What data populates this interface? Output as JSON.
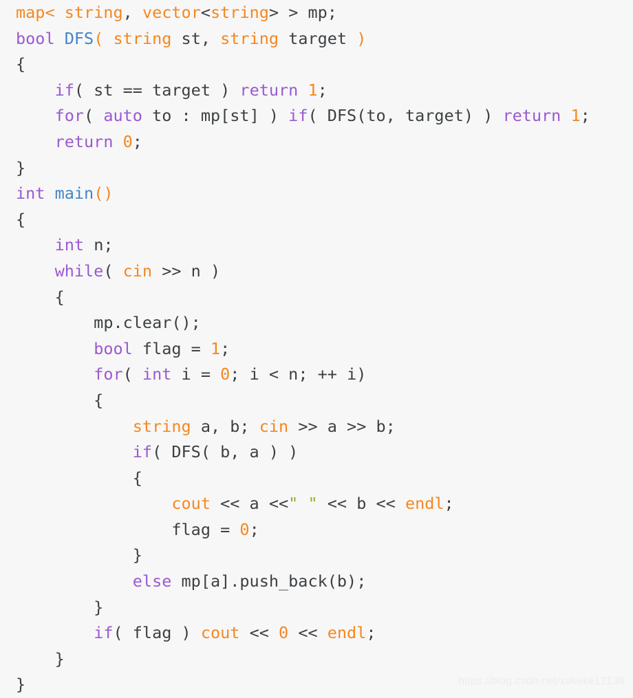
{
  "editor": {
    "language": "C++",
    "background_color": "#f7f7f7",
    "default_text_color": "#3c4043",
    "font_size_px": 23,
    "line_height_px": 37.6,
    "indent_spaces": 4
  },
  "syntax_colors": {
    "keyword": "#9b59d0",
    "type": "#f5871f",
    "builtin": "#f5871f",
    "number": "#f5871f",
    "function_declaration": "#4285c8",
    "string_literal": "#9aaa28",
    "plain": "#3c4043",
    "bracket_highlight": "#f5871f"
  },
  "watermark": {
    "text": "https://blog.csdn.net/xukeke12138",
    "color": "#ececec"
  },
  "code": {
    "plain_text": "map< string, vector<string> > mp;\nbool DFS( string st, string target )\n{\n    if( st == target ) return 1;\n    for( auto to : mp[st] ) if( DFS(to, target) ) return 1;\n    return 0;\n}\nint main()\n{\n    int n;\n    while( cin >> n )\n    {\n        mp.clear();\n        bool flag = 1;\n        for( int i = 0; i < n; ++ i)\n        {\n            string a, b; cin >> a >> b;\n            if( DFS( b, a ) )\n            {\n                cout << a <<\" \" << b << endl;\n                flag = 0;\n            }\n            else mp[a].push_back(b);\n        }\n        if( flag ) cout << 0 << endl;\n    }\n}",
    "line_count": 27,
    "lines": [
      {
        "n": 1,
        "tokens": [
          {
            "t": "map",
            "c": "type"
          },
          {
            "t": "<",
            "c": "bracket"
          },
          {
            "t": " ",
            "c": "plain"
          },
          {
            "t": "string",
            "c": "type"
          },
          {
            "t": ", ",
            "c": "plain"
          },
          {
            "t": "vector",
            "c": "type"
          },
          {
            "t": "<",
            "c": "plain"
          },
          {
            "t": "string",
            "c": "type"
          },
          {
            "t": ">",
            "c": "plain"
          },
          {
            "t": " > mp;",
            "c": "plain"
          }
        ]
      },
      {
        "n": 2,
        "tokens": [
          {
            "t": "bool",
            "c": "keyword"
          },
          {
            "t": " ",
            "c": "plain"
          },
          {
            "t": "DFS",
            "c": "func"
          },
          {
            "t": "(",
            "c": "bracket"
          },
          {
            "t": " ",
            "c": "plain"
          },
          {
            "t": "string",
            "c": "type"
          },
          {
            "t": " st, ",
            "c": "plain"
          },
          {
            "t": "string",
            "c": "type"
          },
          {
            "t": " target ",
            "c": "plain"
          },
          {
            "t": ")",
            "c": "bracket"
          }
        ]
      },
      {
        "n": 3,
        "tokens": [
          {
            "t": "{",
            "c": "plain"
          }
        ]
      },
      {
        "n": 4,
        "tokens": [
          {
            "t": "    ",
            "c": "plain"
          },
          {
            "t": "if",
            "c": "keyword"
          },
          {
            "t": "( st == target ) ",
            "c": "plain"
          },
          {
            "t": "return",
            "c": "keyword"
          },
          {
            "t": " ",
            "c": "plain"
          },
          {
            "t": "1",
            "c": "number"
          },
          {
            "t": ";",
            "c": "plain"
          }
        ]
      },
      {
        "n": 5,
        "tokens": [
          {
            "t": "    ",
            "c": "plain"
          },
          {
            "t": "for",
            "c": "keyword"
          },
          {
            "t": "( ",
            "c": "plain"
          },
          {
            "t": "auto",
            "c": "keyword"
          },
          {
            "t": " to : mp[st] ) ",
            "c": "plain"
          },
          {
            "t": "if",
            "c": "keyword"
          },
          {
            "t": "( DFS(to, target) ) ",
            "c": "plain"
          },
          {
            "t": "return",
            "c": "keyword"
          },
          {
            "t": " ",
            "c": "plain"
          },
          {
            "t": "1",
            "c": "number"
          },
          {
            "t": ";",
            "c": "plain"
          }
        ]
      },
      {
        "n": 6,
        "tokens": [
          {
            "t": "    ",
            "c": "plain"
          },
          {
            "t": "return",
            "c": "keyword"
          },
          {
            "t": " ",
            "c": "plain"
          },
          {
            "t": "0",
            "c": "number"
          },
          {
            "t": ";",
            "c": "plain"
          }
        ]
      },
      {
        "n": 7,
        "tokens": [
          {
            "t": "}",
            "c": "plain"
          }
        ]
      },
      {
        "n": 8,
        "tokens": [
          {
            "t": "int",
            "c": "keyword"
          },
          {
            "t": " ",
            "c": "plain"
          },
          {
            "t": "main",
            "c": "func"
          },
          {
            "t": "()",
            "c": "bracket"
          }
        ]
      },
      {
        "n": 9,
        "tokens": [
          {
            "t": "{",
            "c": "plain"
          }
        ]
      },
      {
        "n": 10,
        "tokens": [
          {
            "t": "    ",
            "c": "plain"
          },
          {
            "t": "int",
            "c": "keyword"
          },
          {
            "t": " n;",
            "c": "plain"
          }
        ]
      },
      {
        "n": 11,
        "tokens": [
          {
            "t": "    ",
            "c": "plain"
          },
          {
            "t": "while",
            "c": "keyword"
          },
          {
            "t": "( ",
            "c": "plain"
          },
          {
            "t": "cin",
            "c": "builtin"
          },
          {
            "t": " >> n )",
            "c": "plain"
          }
        ]
      },
      {
        "n": 12,
        "tokens": [
          {
            "t": "    {",
            "c": "plain"
          }
        ]
      },
      {
        "n": 13,
        "tokens": [
          {
            "t": "        mp.clear();",
            "c": "plain"
          }
        ]
      },
      {
        "n": 14,
        "tokens": [
          {
            "t": "        ",
            "c": "plain"
          },
          {
            "t": "bool",
            "c": "keyword"
          },
          {
            "t": " flag = ",
            "c": "plain"
          },
          {
            "t": "1",
            "c": "number"
          },
          {
            "t": ";",
            "c": "plain"
          }
        ]
      },
      {
        "n": 15,
        "tokens": [
          {
            "t": "        ",
            "c": "plain"
          },
          {
            "t": "for",
            "c": "keyword"
          },
          {
            "t": "( ",
            "c": "plain"
          },
          {
            "t": "int",
            "c": "keyword"
          },
          {
            "t": " i = ",
            "c": "plain"
          },
          {
            "t": "0",
            "c": "number"
          },
          {
            "t": "; i < n; ++ i)",
            "c": "plain"
          }
        ]
      },
      {
        "n": 16,
        "tokens": [
          {
            "t": "        {",
            "c": "plain"
          }
        ]
      },
      {
        "n": 17,
        "tokens": [
          {
            "t": "            ",
            "c": "plain"
          },
          {
            "t": "string",
            "c": "type"
          },
          {
            "t": " a, b; ",
            "c": "plain"
          },
          {
            "t": "cin",
            "c": "builtin"
          },
          {
            "t": " >> a >> b;",
            "c": "plain"
          }
        ]
      },
      {
        "n": 18,
        "tokens": [
          {
            "t": "            ",
            "c": "plain"
          },
          {
            "t": "if",
            "c": "keyword"
          },
          {
            "t": "( DFS( b, a ) )",
            "c": "plain"
          }
        ]
      },
      {
        "n": 19,
        "tokens": [
          {
            "t": "            {",
            "c": "plain"
          }
        ]
      },
      {
        "n": 20,
        "tokens": [
          {
            "t": "                ",
            "c": "plain"
          },
          {
            "t": "cout",
            "c": "builtin"
          },
          {
            "t": " << a <<",
            "c": "plain"
          },
          {
            "t": "\" \"",
            "c": "string"
          },
          {
            "t": " << b << ",
            "c": "plain"
          },
          {
            "t": "endl",
            "c": "builtin"
          },
          {
            "t": ";",
            "c": "plain"
          }
        ]
      },
      {
        "n": 21,
        "tokens": [
          {
            "t": "                flag = ",
            "c": "plain"
          },
          {
            "t": "0",
            "c": "number"
          },
          {
            "t": ";",
            "c": "plain"
          }
        ]
      },
      {
        "n": 22,
        "tokens": [
          {
            "t": "            }",
            "c": "plain"
          }
        ]
      },
      {
        "n": 23,
        "tokens": [
          {
            "t": "            ",
            "c": "plain"
          },
          {
            "t": "else",
            "c": "keyword"
          },
          {
            "t": " mp[a].push_back(b);",
            "c": "plain"
          }
        ]
      },
      {
        "n": 24,
        "tokens": [
          {
            "t": "        }",
            "c": "plain"
          }
        ]
      },
      {
        "n": 25,
        "tokens": [
          {
            "t": "        ",
            "c": "plain"
          },
          {
            "t": "if",
            "c": "keyword"
          },
          {
            "t": "( flag ) ",
            "c": "plain"
          },
          {
            "t": "cout",
            "c": "builtin"
          },
          {
            "t": " << ",
            "c": "plain"
          },
          {
            "t": "0",
            "c": "number"
          },
          {
            "t": " << ",
            "c": "plain"
          },
          {
            "t": "endl",
            "c": "builtin"
          },
          {
            "t": ";",
            "c": "plain"
          }
        ]
      },
      {
        "n": 26,
        "tokens": [
          {
            "t": "    }",
            "c": "plain"
          }
        ]
      },
      {
        "n": 27,
        "tokens": [
          {
            "t": "}",
            "c": "plain"
          }
        ]
      }
    ]
  }
}
